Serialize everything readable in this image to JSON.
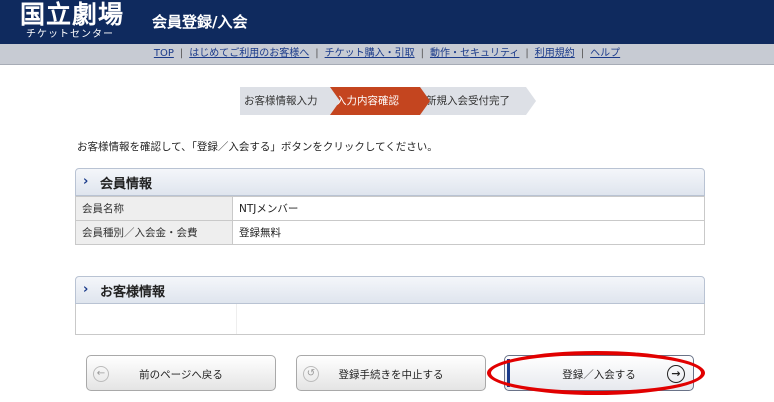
{
  "header": {
    "logo_main": "国立劇場",
    "logo_sub": "チケットセンター",
    "page_title": "会員登録/入会",
    "bg_color": "#0f2a5e"
  },
  "nav": {
    "items": [
      "TOP",
      "はじめてご利用のお客様へ",
      "チケット購入・引取",
      "動作・セキュリティ",
      "利用規約",
      "ヘルプ"
    ],
    "separator": "|"
  },
  "steps": [
    {
      "label": "お客様情報入力",
      "active": false
    },
    {
      "label": "入力内容確認",
      "active": true
    },
    {
      "label": "新規入会受付完了",
      "active": false
    }
  ],
  "instruction": "お客様情報を確認して、「登録／入会する」ボタンをクリックしてください。",
  "member_section": {
    "chevron": "›",
    "title": "会員情報",
    "rows": [
      {
        "label": "会員名称",
        "value": "NTJメンバー"
      },
      {
        "label": "会員種別／入会金・会費",
        "value": "登録無料"
      }
    ]
  },
  "customer_section": {
    "chevron": "›",
    "title": "お客様情報"
  },
  "buttons": {
    "back": "前のページへ戻る",
    "back_icon": "arrow-left-icon",
    "cancel": "登録手続きを中止する",
    "cancel_icon": "undo-icon",
    "register": "登録／入会する",
    "register_icon": "arrow-right-circle-icon"
  },
  "colors": {
    "active_step": "#c4451f",
    "highlight": "#e10000"
  }
}
